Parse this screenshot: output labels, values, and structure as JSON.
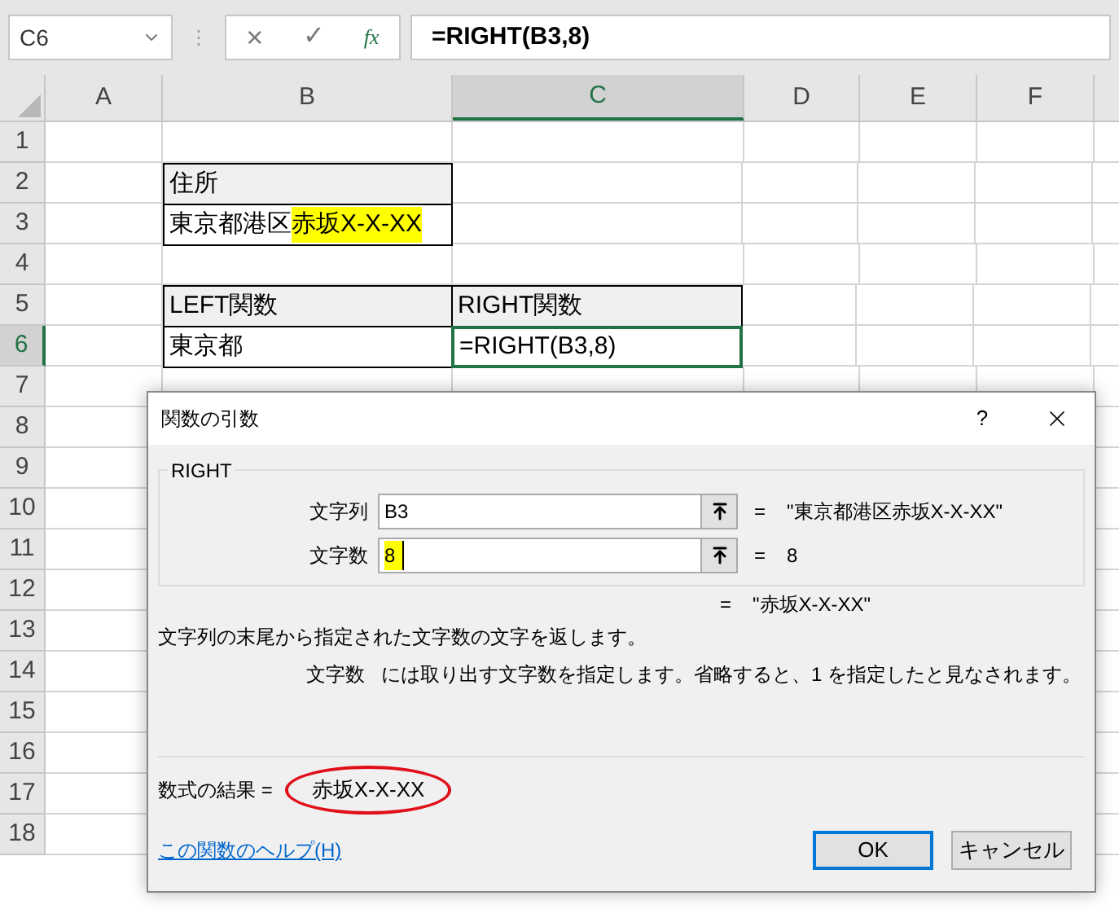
{
  "name_box": "C6",
  "toolbar_grip": "⋮",
  "formula_bar": {
    "cancel": "×",
    "enter": "✓",
    "fx": "fx",
    "formula": "=RIGHT(B3,8)"
  },
  "columns": [
    {
      "label": "A",
      "selected": false
    },
    {
      "label": "B",
      "selected": false
    },
    {
      "label": "C",
      "selected": true
    },
    {
      "label": "D",
      "selected": false
    },
    {
      "label": "E",
      "selected": false
    },
    {
      "label": "F",
      "selected": false
    }
  ],
  "rows": [
    {
      "label": "1",
      "selected": false
    },
    {
      "label": "2",
      "selected": false,
      "cells": [
        {
          "kind": "empty"
        },
        {
          "kind": "header",
          "text": "住所",
          "selected": false
        },
        {
          "kind": "empty"
        },
        {
          "kind": "empty"
        },
        {
          "kind": "empty"
        },
        {
          "kind": "empty"
        }
      ]
    },
    {
      "label": "3",
      "selected": false,
      "cells": [
        {
          "kind": "empty"
        },
        {
          "kind": "value",
          "text": "東京都港区",
          "highlight": "赤坂X-X-XX",
          "selected": false
        },
        {
          "kind": "empty"
        },
        {
          "kind": "empty"
        },
        {
          "kind": "empty"
        },
        {
          "kind": "empty"
        }
      ]
    },
    {
      "label": "4",
      "selected": false
    },
    {
      "label": "5",
      "selected": false,
      "cells": [
        {
          "kind": "empty"
        },
        {
          "kind": "header",
          "text": "LEFT関数",
          "selected": false
        },
        {
          "kind": "header",
          "text": "RIGHT関数",
          "selected": false
        },
        {
          "kind": "empty"
        },
        {
          "kind": "empty"
        },
        {
          "kind": "empty"
        }
      ]
    },
    {
      "label": "6",
      "selected": true,
      "cells": [
        {
          "kind": "empty"
        },
        {
          "kind": "value",
          "text": "東京都",
          "selected": false
        },
        {
          "kind": "value",
          "text": "=RIGHT(B3,8)",
          "selected": true
        },
        {
          "kind": "empty"
        },
        {
          "kind": "empty"
        },
        {
          "kind": "empty"
        }
      ]
    },
    {
      "label": "7",
      "selected": false
    },
    {
      "label": "8",
      "selected": false
    },
    {
      "label": "9",
      "selected": false
    },
    {
      "label": "10",
      "selected": false
    },
    {
      "label": "11",
      "selected": false
    },
    {
      "label": "12",
      "selected": false
    },
    {
      "label": "13",
      "selected": false
    },
    {
      "label": "14",
      "selected": false
    },
    {
      "label": "15",
      "selected": false
    },
    {
      "label": "16",
      "selected": false
    },
    {
      "label": "17",
      "selected": false
    },
    {
      "label": "18",
      "selected": false
    }
  ],
  "dialog": {
    "title": "関数の引数",
    "help": "?",
    "function_name": "RIGHT",
    "arguments": [
      {
        "label": "文字列",
        "value": "B3",
        "highlighted": false,
        "equals": "=",
        "result": "\"東京都港区赤坂X-X-XX\""
      },
      {
        "label": "文字数",
        "value": "8",
        "highlighted": true,
        "equals": "=",
        "result": "8"
      }
    ],
    "overall_equals": "=",
    "overall_result": "\"赤坂X-X-XX\"",
    "description": "文字列の末尾から指定された文字数の文字を返します。",
    "arg_help": {
      "name": "文字数",
      "text": "には取り出す文字数を指定します。省略すると、1 を指定したと見なされます。"
    },
    "formula_result": {
      "label": "数式の結果 =",
      "value": "赤坂X-X-XX",
      "circled": true
    },
    "help_link": "この関数のヘルプ(H)",
    "buttons": [
      {
        "label": "OK",
        "default": true
      },
      {
        "label": "キャンセル",
        "default": false
      }
    ]
  }
}
